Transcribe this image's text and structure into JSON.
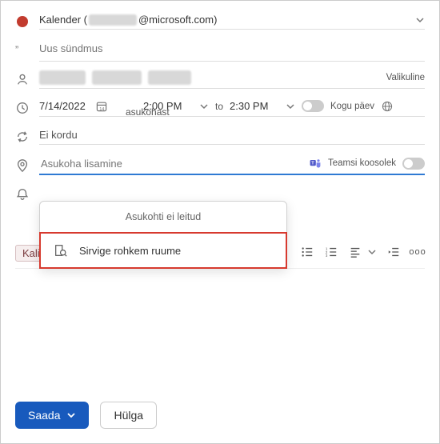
{
  "calendar": {
    "prefix": "Kalender (",
    "domain": "@microsoft.com)"
  },
  "title": {
    "placeholder": "Uus sündmus"
  },
  "attendees": {
    "optional": "Valikuline"
  },
  "when": {
    "date": "7/14/2022",
    "overlay": "asukohast",
    "startTime": "2:00 PM",
    "toLabel": "to",
    "endTime": "2:30 PM",
    "allDay": "Kogu päev"
  },
  "recurrence": {
    "text": "Ei kordu"
  },
  "location": {
    "placeholder": "Asukoha lisamine",
    "teams": "Teamsi koosolek"
  },
  "popup": {
    "header": "Asukohti ei leitud",
    "browseMore": "Sirvige rohkem ruume"
  },
  "toolbar": {
    "fontName": "Kalibri"
  },
  "footer": {
    "send": "Saada",
    "discard": "Hülga"
  }
}
